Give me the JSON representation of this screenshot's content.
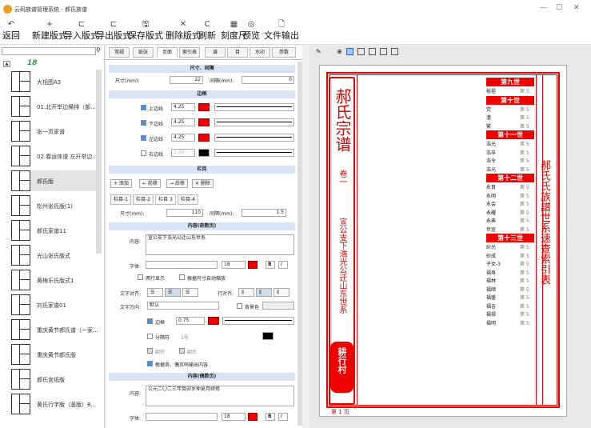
{
  "window": {
    "title": "云码族谱管理系统 - 郝氏族谱",
    "min": "—",
    "max": "☐",
    "close": "✕"
  },
  "toolbar": [
    {
      "icon": "↶",
      "label": "返回"
    },
    {
      "icon": "+",
      "label": "新建版式"
    },
    {
      "icon": "⊏",
      "label": "导入版式"
    },
    {
      "icon": "⊏",
      "label": "导出版式"
    },
    {
      "icon": "🖫",
      "label": "保存版式"
    },
    {
      "icon": "✕",
      "label": "删除版式"
    },
    {
      "icon": "C",
      "label": "刷新"
    },
    {
      "icon": "▦",
      "label": "刻度尺"
    },
    {
      "icon": "◎",
      "label": "预览"
    },
    {
      "icon": "🗋",
      "label": "文件输出"
    }
  ],
  "left": {
    "group": "18",
    "items": [
      "大括图A3",
      "01.北开举边横排（部...",
      "张一页家谱",
      "02.春运体谱 左开举边...",
      "郝氏版",
      "松州张氏版(1)",
      "郝氏家谱11",
      "光山张氏版式",
      "黄梅乐氏版式1",
      "刘氏家谱01",
      "重庆黄节郝氏谱（一家...",
      "重庆黄节郝氏版",
      "郝氏宣纸版",
      "黄氏行字版（竖版）8..."
    ]
  },
  "tabs": [
    "常规",
    "纸张",
    "页面",
    "索引表",
    "谱",
    "目",
    "水印",
    "参数"
  ],
  "panel": {
    "size_title": "尺寸、间隔",
    "size_label": "尺寸(mm):",
    "size_val": "22",
    "gap_label": "间隔(mm):",
    "gap_val": "0",
    "border_title": "边框",
    "borders": [
      {
        "label": "上边线",
        "val": "4.25"
      },
      {
        "label": "下边线",
        "val": "4.25"
      },
      {
        "label": "左边线",
        "val": "4.25"
      },
      {
        "label": "右边线",
        "val": "2.25"
      }
    ],
    "col_title": "栏目",
    "col_btns": [
      "+ 添加",
      "← 前移",
      "→ 后移",
      "✕ 删除"
    ],
    "col_tabs": [
      "栏目-1",
      "栏目-2",
      "栏目 3",
      "栏目-4"
    ],
    "col_size_label": "尺寸(mm):",
    "col_size_val": "110",
    "col_gap_label": "间隔(mm):",
    "col_gap_val": "1.5",
    "odd_title": "内容(奇数页)",
    "content_label": "内容:",
    "content_val": "宣公支下浩光公迁山东世系",
    "font_label": "字体:",
    "font_size": "18",
    "bold": "B",
    "italic": "I",
    "two_line": "两行显示",
    "auto_size": "根据尺寸自动缩放",
    "align_label": "文字对齐:",
    "valign_label": "行对齐:",
    "dir_label": "文字方向:",
    "dir_val": "默认",
    "bg_label": "背景色",
    "border_label": "边框",
    "border_val": "0.75",
    "sep_label": "分隔符",
    "sep_val": "1号",
    "flip1": "翻转",
    "flip2": "翻后",
    "odd_even": "根据奇、偶页码输出内容",
    "even_title": "内容(偶数页)",
    "even_content_val": "公元二〇二三年癸卯岁仲夏月续修"
  },
  "preview": {
    "title": "郝氏宗谱",
    "mid": "卷一",
    "sub": "宣公支下浩光公迁山东世系",
    "seal": "耕行村",
    "side": "郝氏氏族譜世系速查索引表",
    "page": "第 1 页",
    "gens": [
      {
        "title": "第九世",
        "names": [
          [
            "裕祖",
            "第 5"
          ]
        ]
      },
      {
        "title": "第十世",
        "names": [
          [
            "党",
            "第 5"
          ],
          [
            "潼",
            "第 5"
          ],
          [
            "繁",
            "第 5"
          ]
        ]
      },
      {
        "title": "第十一世",
        "names": [
          [
            "浩光",
            "第 5"
          ],
          [
            "浩孚",
            "第 5"
          ],
          [
            "浩令",
            "第 5"
          ],
          [
            "浩光",
            "第 5"
          ]
        ]
      },
      {
        "title": "第十二世",
        "names": [
          [
            "永育",
            "第 5"
          ],
          [
            "永明",
            "第 5"
          ],
          [
            "永会",
            "第 5"
          ],
          [
            "永耀",
            "第 5"
          ],
          [
            "永典",
            "第 5"
          ],
          [
            "世宣",
            "第 5"
          ]
        ]
      },
      {
        "title": "第十三世",
        "names": [
          [
            "砂光",
            "第 5"
          ],
          [
            "砂成",
            "第 5"
          ],
          [
            "子女-3",
            "第 5"
          ],
          [
            "福寿",
            "第 5"
          ],
          [
            "福林",
            "第 5"
          ],
          [
            "福顺",
            "第 5"
          ],
          [
            "福盛",
            "第 5"
          ],
          [
            "福吉",
            "第 5"
          ],
          [
            "福禄",
            "第 5"
          ],
          [
            "福明",
            "第 5"
          ]
        ]
      }
    ]
  }
}
